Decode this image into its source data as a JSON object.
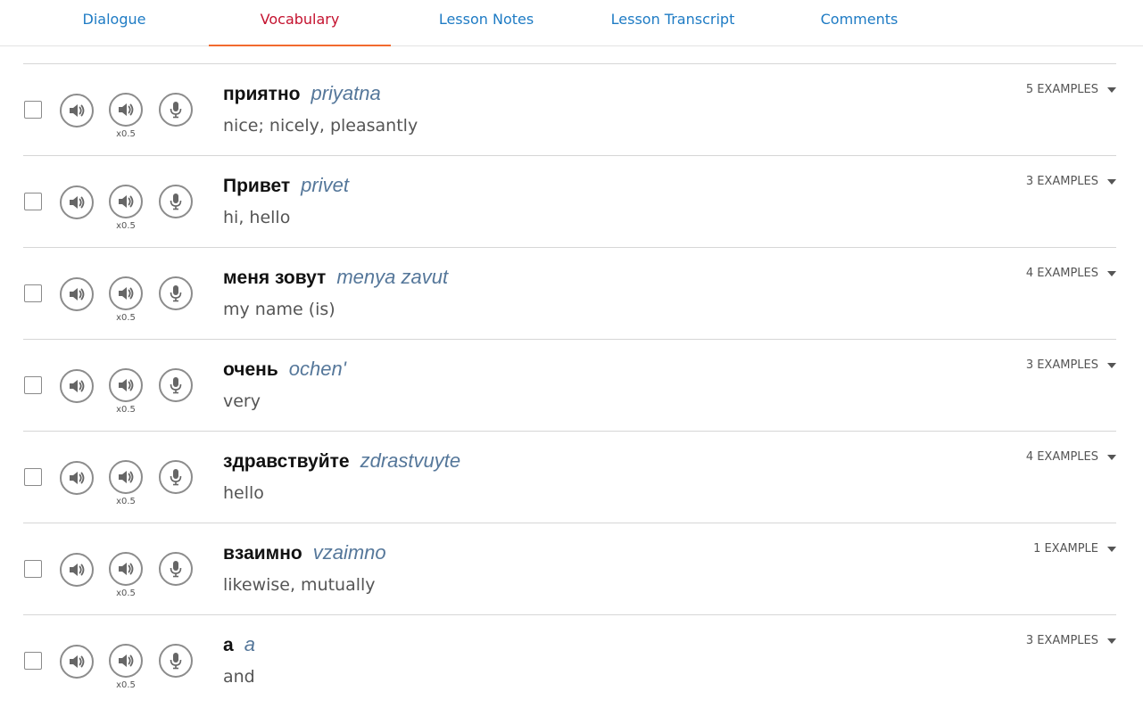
{
  "tabs": [
    {
      "label": "Dialogue",
      "active": false
    },
    {
      "label": "Vocabulary",
      "active": true
    },
    {
      "label": "Lesson Notes",
      "active": false
    },
    {
      "label": "Lesson Transcript",
      "active": false
    },
    {
      "label": "Comments",
      "active": false
    }
  ],
  "colors": {
    "tab_link": "#1e7bc4",
    "tab_active": "#c4122f",
    "tab_underline": "#f26a2e",
    "transliteration": "#55779a"
  },
  "icons": {
    "play": "speaker-icon",
    "slow_play": "speaker-icon",
    "record": "microphone-icon",
    "expand": "caret-down-icon"
  },
  "slow_label": "x0.5",
  "vocabulary": [
    {
      "word": "приятно",
      "transliteration": "priyatna",
      "meaning": "nice; nicely, pleasantly",
      "examples": "5 EXAMPLES"
    },
    {
      "word": "Привет",
      "transliteration": "privet",
      "meaning": "hi, hello",
      "examples": "3 EXAMPLES"
    },
    {
      "word": "меня зовут",
      "transliteration": "menya zavut",
      "meaning": "my name (is)",
      "examples": "4 EXAMPLES"
    },
    {
      "word": "очень",
      "transliteration": "ochen'",
      "meaning": "very",
      "examples": "3 EXAMPLES"
    },
    {
      "word": "здравствуйте",
      "transliteration": "zdrastvuyte",
      "meaning": "hello",
      "examples": "4 EXAMPLES"
    },
    {
      "word": "взаимно",
      "transliteration": "vzaimno",
      "meaning": "likewise, mutually",
      "examples": "1 EXAMPLE"
    },
    {
      "word": "а",
      "transliteration": "a",
      "meaning": "and",
      "examples": "3 EXAMPLES"
    }
  ]
}
